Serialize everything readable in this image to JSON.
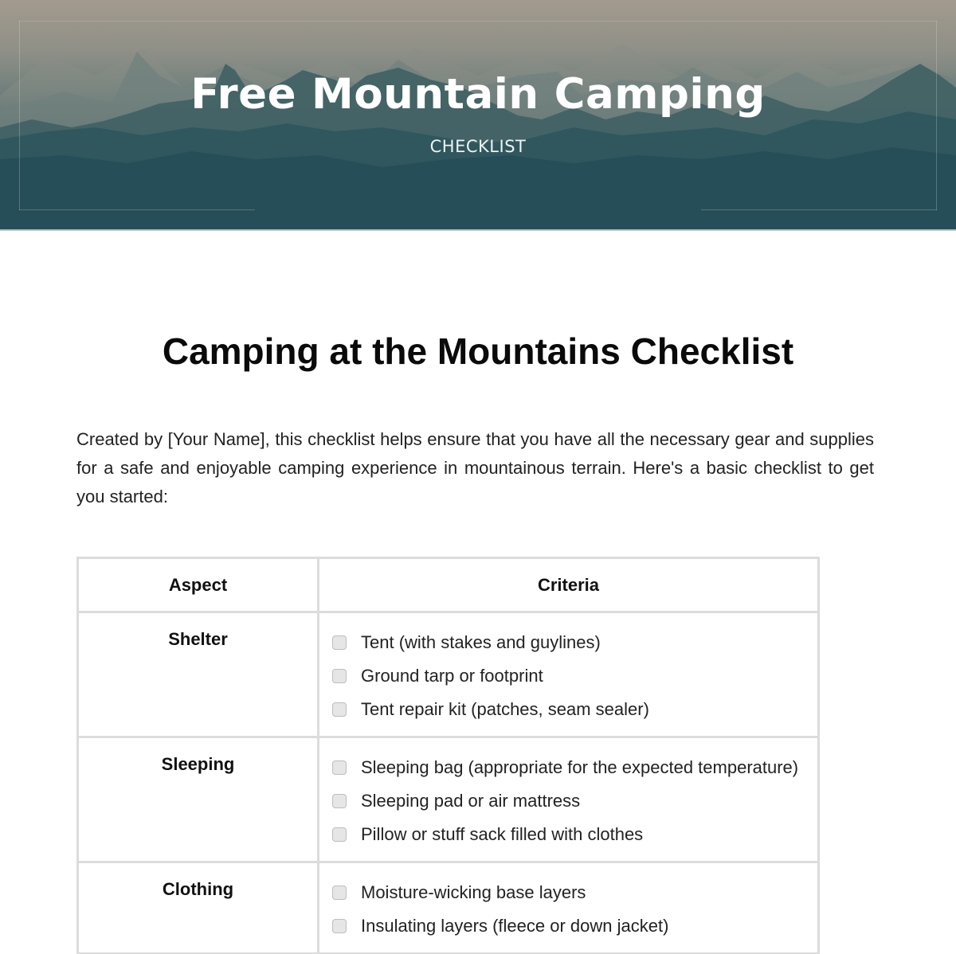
{
  "banner": {
    "title": "Free Mountain Camping",
    "subtitle": "CHECKLIST",
    "colors": {
      "sky": "#a39a8e",
      "deep_teal": "#1d4a56"
    }
  },
  "document": {
    "title": "Camping at the Mountains Checklist",
    "intro": "Created by [Your Name], this checklist helps ensure that you have all the necessary gear and supplies for a safe and enjoyable camping experience in mountainous terrain. Here's a basic checklist to get you started:"
  },
  "table": {
    "headers": {
      "aspect": "Aspect",
      "criteria": "Criteria"
    },
    "rows": [
      {
        "aspect": "Shelter",
        "items": [
          {
            "label": "Tent (with stakes and guylines)",
            "checked": false
          },
          {
            "label": "Ground tarp or footprint",
            "checked": false
          },
          {
            "label": "Tent repair kit (patches, seam sealer)",
            "checked": false
          }
        ]
      },
      {
        "aspect": "Sleeping",
        "items": [
          {
            "label": "Sleeping bag (appropriate for the expected temperature)",
            "checked": false
          },
          {
            "label": "Sleeping pad or air mattress",
            "checked": false
          },
          {
            "label": "Pillow or stuff sack filled with clothes",
            "checked": false
          }
        ]
      },
      {
        "aspect": "Clothing",
        "items": [
          {
            "label": "Moisture-wicking base layers",
            "checked": false
          },
          {
            "label": "Insulating layers (fleece or down jacket)",
            "checked": false
          }
        ]
      }
    ]
  },
  "icons": {
    "checkbox": "checkbox-unchecked-icon"
  }
}
